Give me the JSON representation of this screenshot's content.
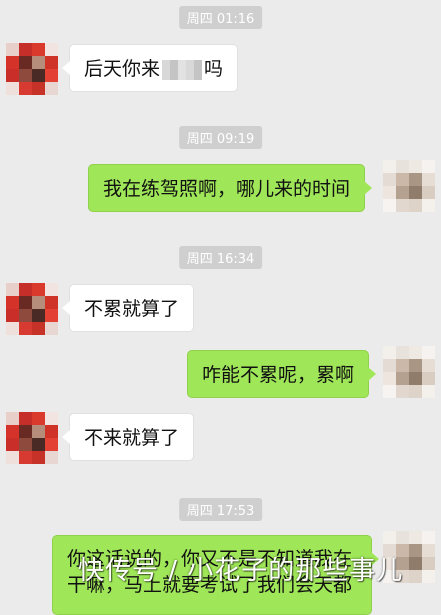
{
  "timestamps": [
    "周四 01:16",
    "周四 09:19",
    "周四 16:34",
    "周四 17:53"
  ],
  "messages": {
    "m1_before": "后天你来",
    "m1_after": "吗",
    "m2": "我在练驾照啊，哪儿来的时间",
    "m3": "不累就算了",
    "m4": "咋能不累呢，累啊",
    "m5": "不来就算了",
    "m6_line1": "你这话说的，你又不是不知道我在",
    "m6_line2": "干嘛，马上就要考试了我们会天都"
  },
  "watermark": "快传号 / 小花子的那些事儿",
  "colors": {
    "background": "#ebebeb",
    "sent_bubble": "#9fe658",
    "received_bubble": "#ffffff",
    "timestamp_bg": "#cfcfcf"
  }
}
